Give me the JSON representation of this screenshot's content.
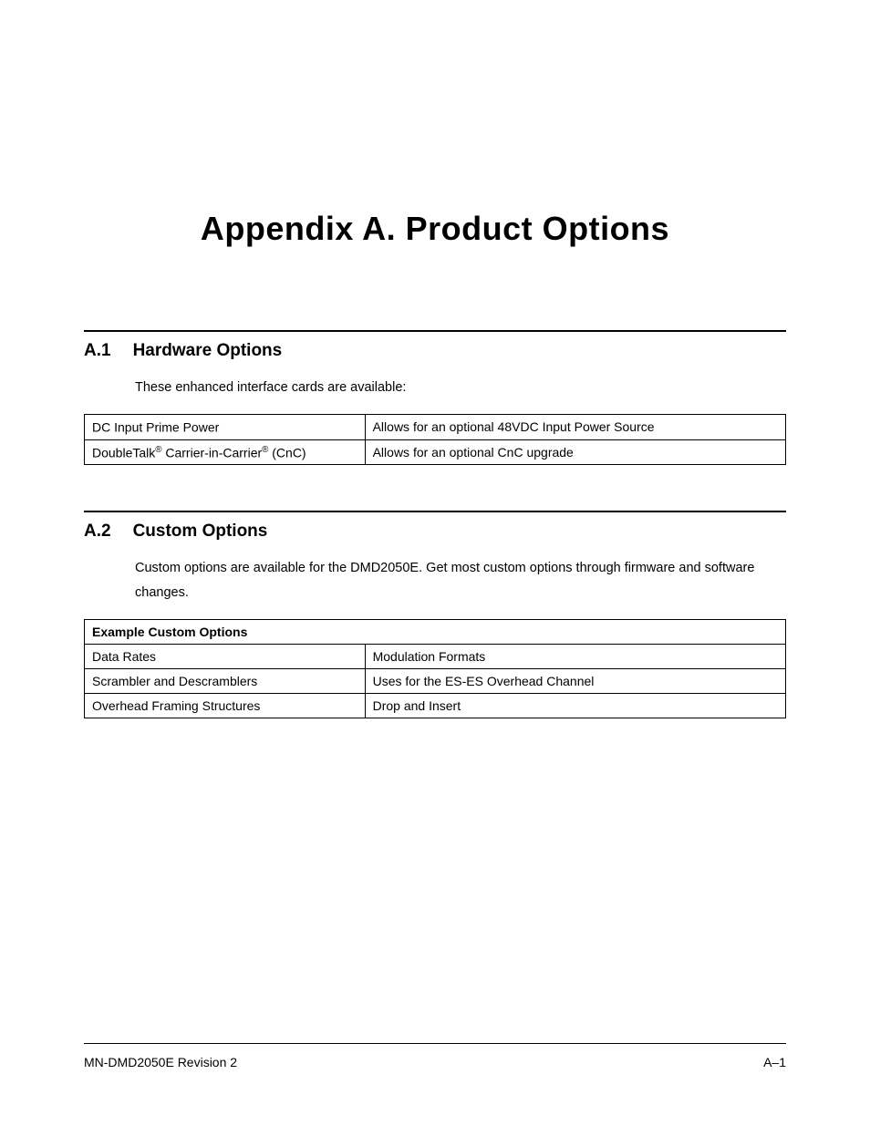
{
  "title": "Appendix A.   Product Options",
  "sections": {
    "a1": {
      "number": "A.1",
      "heading": "Hardware Options",
      "intro": "These enhanced interface cards are available:",
      "table": {
        "rows": [
          {
            "left_prefix": "DC Input Prime Power",
            "left_sup1": "",
            "left_mid": "",
            "left_sup2": "",
            "left_suffix": "",
            "right": "Allows for an optional 48VDC Input Power Source"
          },
          {
            "left_prefix": "DoubleTalk",
            "left_sup1": "®",
            "left_mid": " Carrier-in-Carrier",
            "left_sup2": "®",
            "left_suffix": " (CnC)",
            "right": "Allows for an optional CnC upgrade"
          }
        ]
      }
    },
    "a2": {
      "number": "A.2",
      "heading": "Custom Options",
      "intro": "Custom options are available for the DMD2050E.  Get most custom options through firmware and software changes.",
      "table": {
        "header": "Example Custom Options",
        "rows": [
          {
            "left": "Data Rates",
            "right": "Modulation Formats"
          },
          {
            "left": "Scrambler and Descramblers",
            "right": "Uses for the ES-ES Overhead Channel"
          },
          {
            "left": "Overhead Framing Structures",
            "right": "Drop and Insert"
          }
        ]
      }
    }
  },
  "footer": {
    "left": "MN-DMD2050E   Revision 2",
    "right": "A–1"
  }
}
